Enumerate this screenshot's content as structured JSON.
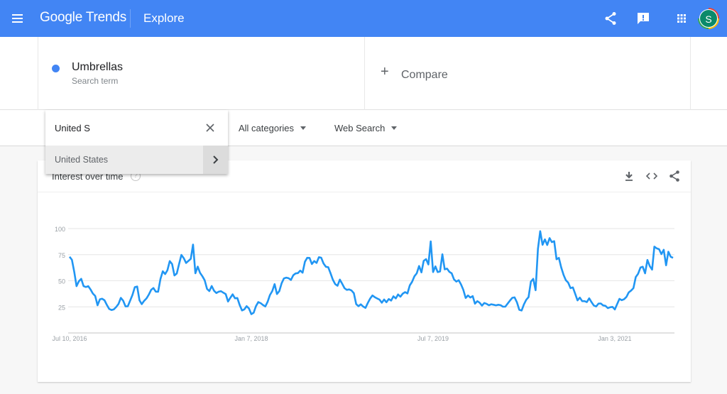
{
  "header": {
    "logo_brand": "Google",
    "logo_product": "Trends",
    "page": "Explore",
    "avatar_initial": "S",
    "accent_color": "#4285f4"
  },
  "search_terms": [
    {
      "name": "Umbrellas",
      "type": "Search term",
      "color": "#4285f4"
    }
  ],
  "compare": {
    "label": "Compare"
  },
  "filters": {
    "geo_input_value": "United S",
    "geo_suggestion": "United States",
    "category": "All categories",
    "property": "Web Search"
  },
  "card": {
    "title": "Interest over time",
    "help": "?"
  },
  "chart_data": {
    "type": "line",
    "title": "Interest over time",
    "series_name": "Umbrellas",
    "series_color": "#2196f3",
    "ylim": [
      0,
      100
    ],
    "yticks": [
      "100",
      "75",
      "50",
      "25"
    ],
    "ytick_values": [
      100,
      75,
      50,
      25
    ],
    "xlabels": [
      "Jul 10, 2016",
      "Jan 7, 2018",
      "Jul 7, 2019",
      "Jan 3, 2021"
    ],
    "xlabel_positions": [
      0,
      78,
      156,
      234
    ],
    "grid": true,
    "x_count": 260,
    "values": [
      73,
      70,
      58,
      44,
      50,
      52,
      44,
      44,
      45,
      41,
      37,
      35,
      24,
      35,
      32,
      31,
      25,
      22,
      22,
      23,
      26,
      29,
      37,
      26,
      25,
      26,
      36,
      37,
      52,
      35,
      26,
      30,
      32,
      35,
      40,
      44,
      41,
      36,
      49,
      60,
      56,
      58,
      69,
      68,
      55,
      56,
      65,
      75,
      72,
      67,
      69,
      71,
      85,
      56,
      64,
      57,
      54,
      50,
      41,
      40,
      46,
      39,
      38,
      40,
      40,
      38,
      37,
      27,
      37,
      37,
      31,
      35,
      21,
      22,
      23,
      28,
      19,
      17,
      22,
      30,
      29,
      28,
      25,
      26,
      37,
      35,
      51,
      37,
      38,
      46,
      52,
      53,
      53,
      50,
      55,
      57,
      57,
      60,
      57,
      68,
      72,
      72,
      66,
      69,
      67,
      73,
      72,
      66,
      63,
      63,
      56,
      50,
      46,
      45,
      53,
      45,
      42,
      41,
      42,
      40,
      37,
      22,
      28,
      27,
      24,
      24,
      33,
      33,
      39,
      29,
      38,
      24,
      36,
      26,
      35,
      28,
      37,
      31,
      38,
      34,
      37,
      40,
      36,
      45,
      48,
      54,
      56,
      65,
      57,
      69,
      71,
      65,
      88,
      58,
      64,
      58,
      59,
      77,
      59,
      62,
      58,
      57,
      50,
      49,
      51,
      45,
      40,
      31,
      38,
      32,
      37,
      23,
      35,
      25,
      27,
      30,
      26,
      27,
      28,
      26,
      27,
      27,
      26,
      24,
      27,
      30,
      33,
      35,
      32,
      23,
      20,
      26,
      32,
      31,
      48,
      55,
      35,
      78,
      99,
      84,
      90,
      84,
      91,
      87,
      88,
      70,
      72,
      62,
      55,
      50,
      48,
      42,
      44,
      36,
      30,
      35,
      29,
      31,
      29,
      35,
      27,
      26,
      25,
      30,
      27,
      26,
      26,
      22,
      27,
      23,
      22,
      34,
      31,
      32,
      33,
      37,
      42,
      38,
      53,
      55,
      61,
      67,
      53,
      71,
      66,
      56,
      83,
      81,
      81,
      75,
      81,
      64,
      78,
      73,
      72
    ]
  }
}
